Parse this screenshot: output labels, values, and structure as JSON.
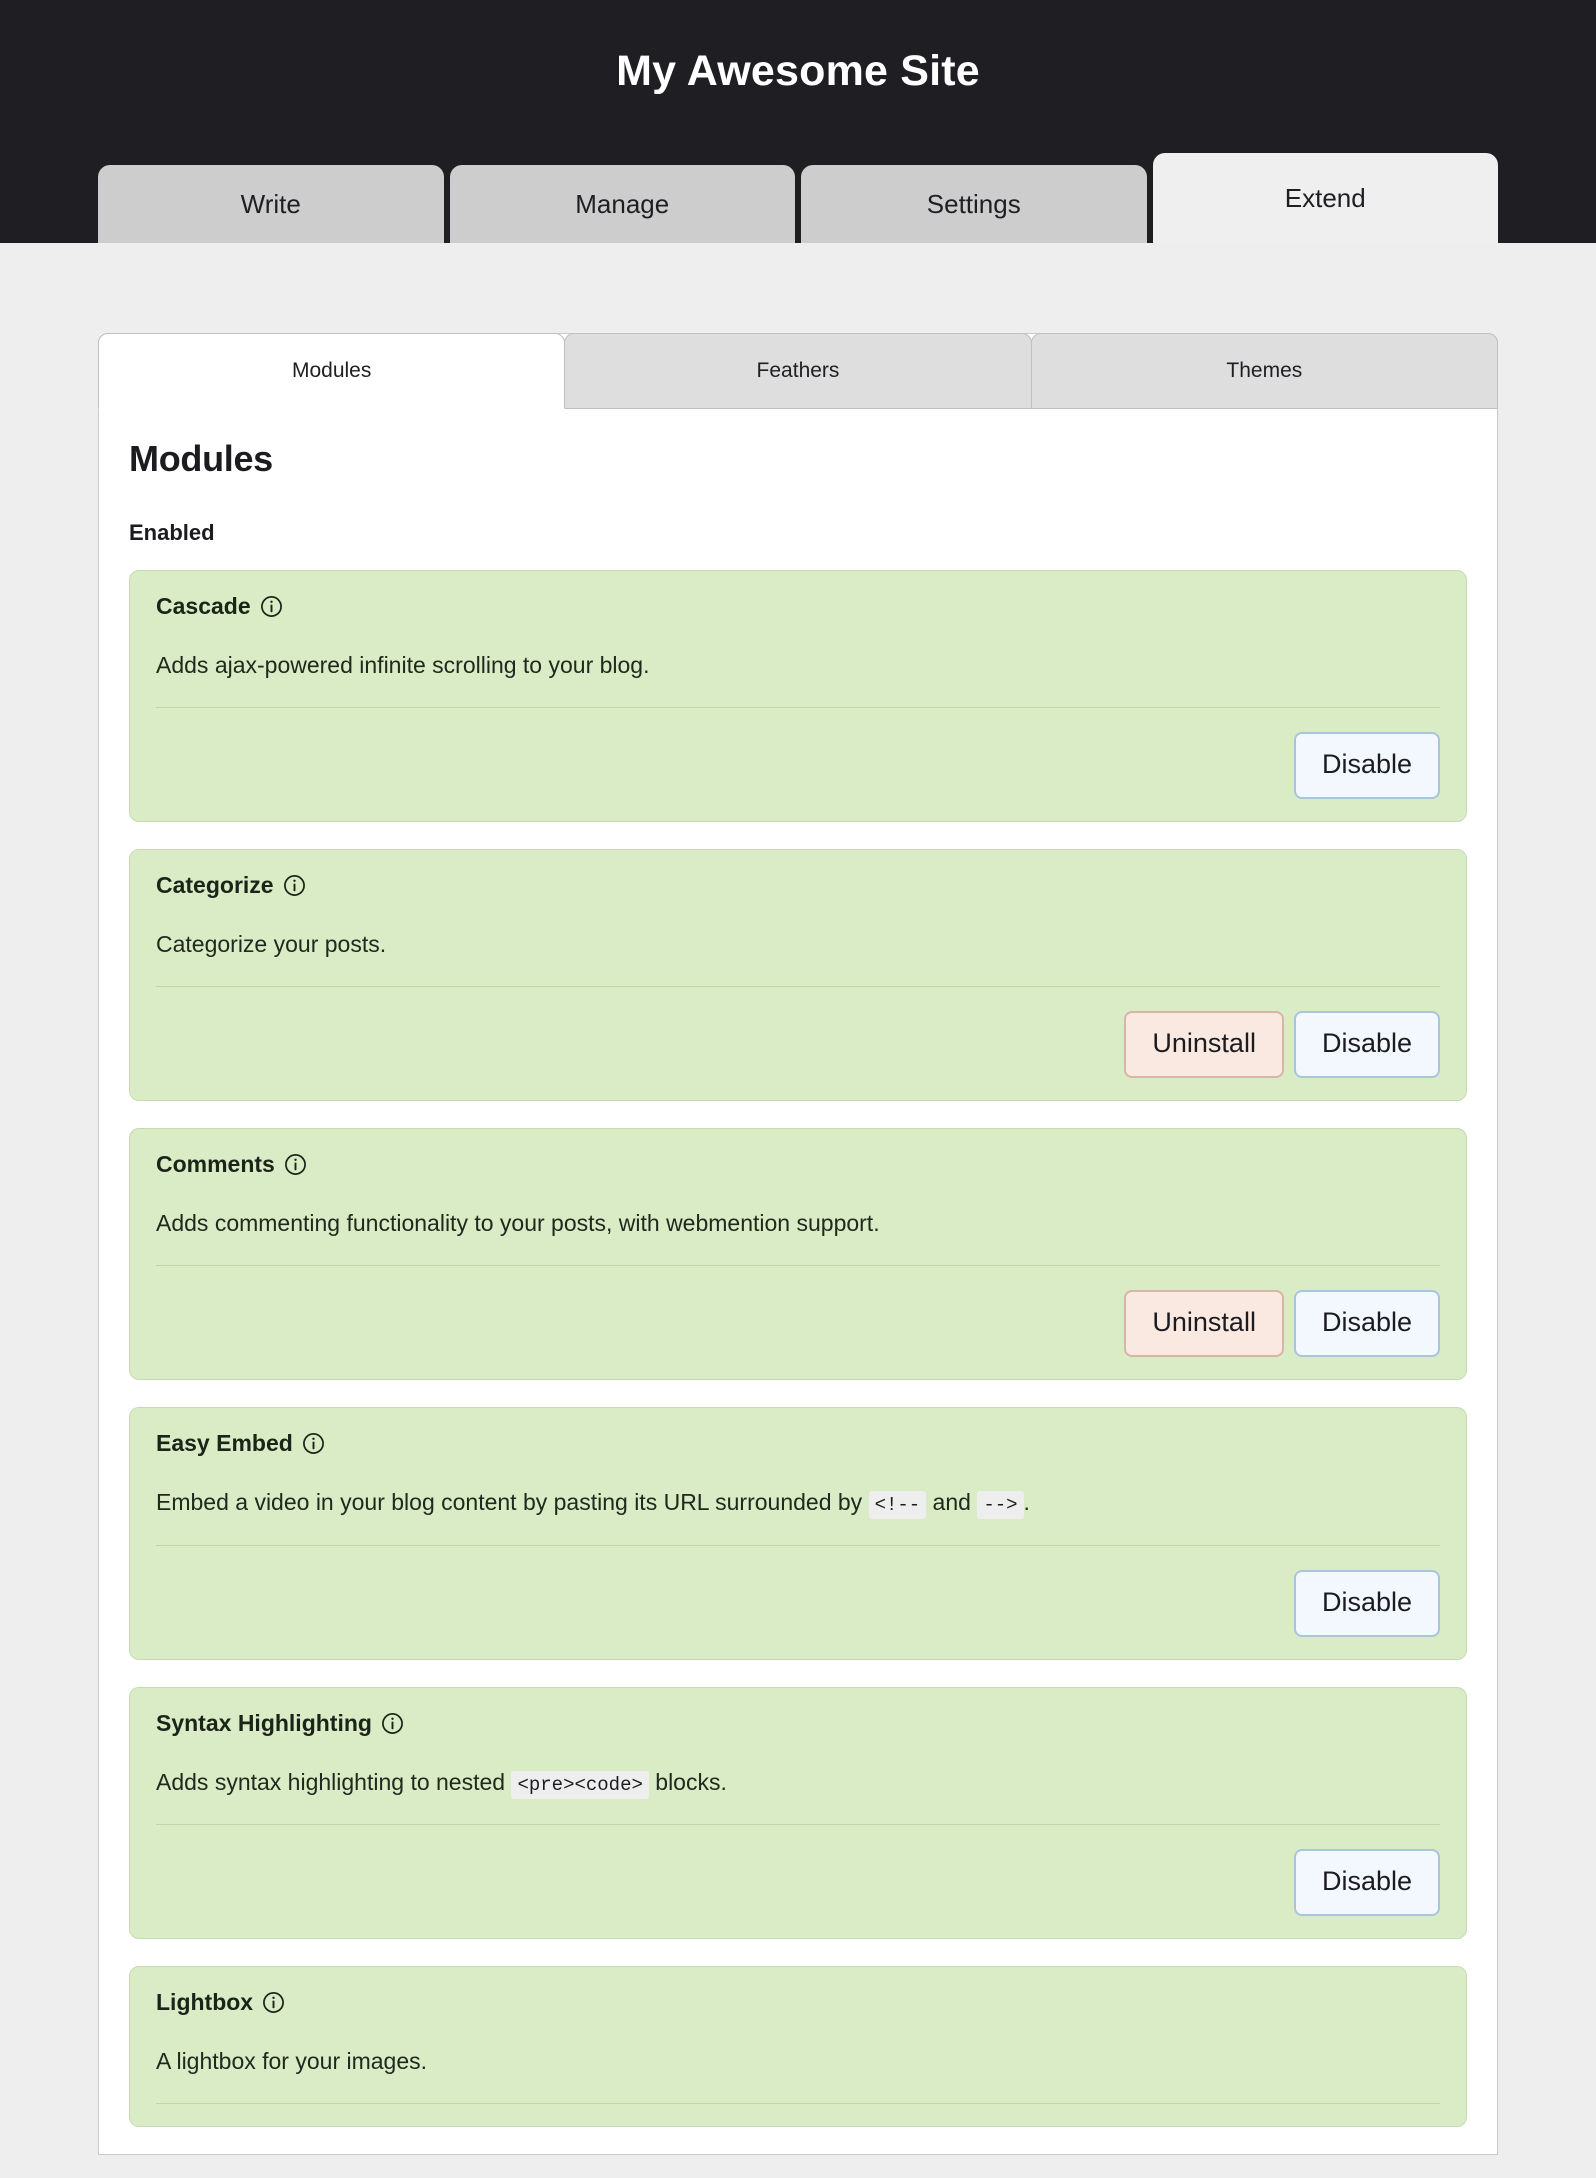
{
  "header": {
    "site_title": "My Awesome Site",
    "tabs": [
      {
        "label": "Write",
        "active": false
      },
      {
        "label": "Manage",
        "active": false
      },
      {
        "label": "Settings",
        "active": false
      },
      {
        "label": "Extend",
        "active": true
      }
    ]
  },
  "sub_tabs": [
    {
      "label": "Modules",
      "active": true
    },
    {
      "label": "Feathers",
      "active": false
    },
    {
      "label": "Themes",
      "active": false
    }
  ],
  "main": {
    "section_title": "Modules",
    "group_label": "Enabled",
    "info_icon_name": "info-icon",
    "buttons": {
      "disable": "Disable",
      "uninstall": "Uninstall"
    },
    "modules": [
      {
        "name": "Cascade",
        "desc_parts": [
          {
            "type": "text",
            "value": "Adds ajax-powered infinite scrolling to your blog."
          }
        ],
        "actions": [
          "Disable"
        ]
      },
      {
        "name": "Categorize",
        "desc_parts": [
          {
            "type": "text",
            "value": "Categorize your posts."
          }
        ],
        "actions": [
          "Uninstall",
          "Disable"
        ]
      },
      {
        "name": "Comments",
        "desc_parts": [
          {
            "type": "text",
            "value": "Adds commenting functionality to your posts, with webmention support."
          }
        ],
        "actions": [
          "Uninstall",
          "Disable"
        ]
      },
      {
        "name": "Easy Embed",
        "desc_parts": [
          {
            "type": "text",
            "value": "Embed a video in your blog content by pasting its URL surrounded by "
          },
          {
            "type": "code",
            "value": "<!--"
          },
          {
            "type": "text",
            "value": " and "
          },
          {
            "type": "code",
            "value": "-->"
          },
          {
            "type": "text",
            "value": "."
          }
        ],
        "actions": [
          "Disable"
        ]
      },
      {
        "name": "Syntax Highlighting",
        "desc_parts": [
          {
            "type": "text",
            "value": "Adds syntax highlighting to nested "
          },
          {
            "type": "code",
            "value": "<pre><code>"
          },
          {
            "type": "text",
            "value": " blocks."
          }
        ],
        "actions": [
          "Disable"
        ]
      },
      {
        "name": "Lightbox",
        "desc_parts": [
          {
            "type": "text",
            "value": "A lightbox for your images."
          }
        ],
        "actions": []
      }
    ]
  },
  "colors": {
    "header_bg": "#1f1f23",
    "page_bg": "#eeeeee",
    "card_bg": "#d9ecc6",
    "card_border": "#c5dcb1",
    "disable_bg": "#f2f8fd",
    "disable_border": "#a9c5dc",
    "uninstall_bg": "#fae9e1",
    "uninstall_border": "#d7b6a6"
  }
}
